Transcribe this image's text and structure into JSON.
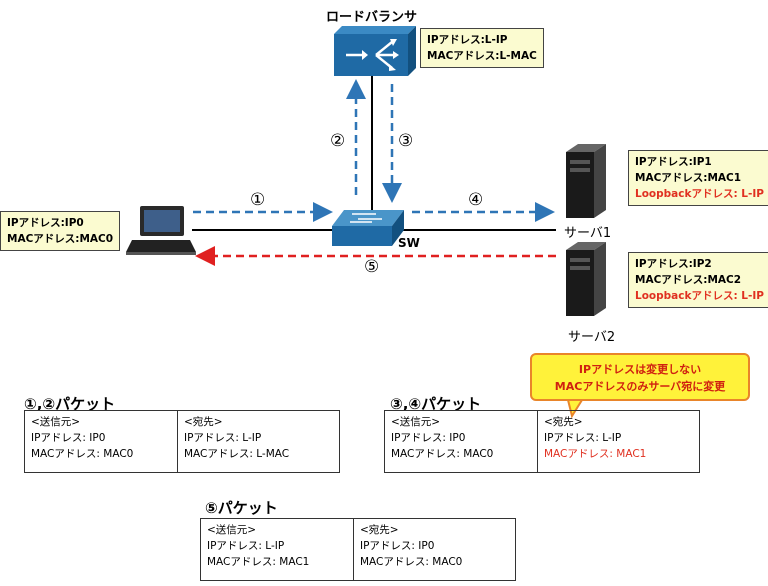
{
  "load_balancer": {
    "title": "ロードバランサ",
    "ip": "IPアドレス:L-IP",
    "mac": "MACアドレス:L-MAC"
  },
  "client": {
    "ip": "IPアドレス:IP0",
    "mac": "MACアドレス:MAC0"
  },
  "switch": {
    "label": "SW"
  },
  "server1": {
    "label": "サーバ1",
    "ip": "IPアドレス:IP1",
    "mac": "MACアドレス:MAC1",
    "loopback": "Loopbackアドレス: L-IP"
  },
  "server2": {
    "label": "サーバ2",
    "ip": "IPアドレス:IP2",
    "mac": "MACアドレス:MAC2",
    "loopback": "Loopbackアドレス: L-IP"
  },
  "steps": {
    "s1": "①",
    "s2": "②",
    "s3": "③",
    "s4": "④",
    "s5": "⑤"
  },
  "callout": {
    "line1": "IPアドレスは変更しない",
    "line2": "MACアドレスのみサーバ宛に変更"
  },
  "packet12": {
    "title": "①,②パケット",
    "src_head": "<送信元>",
    "src_ip": "IPアドレス: IP0",
    "src_mac": "MACアドレス: MAC0",
    "dst_head": "<宛先>",
    "dst_ip": "IPアドレス: L-IP",
    "dst_mac": "MACアドレス: L-MAC"
  },
  "packet34": {
    "title": "③,④パケット",
    "src_head": "<送信元>",
    "src_ip": "IPアドレス: IP0",
    "src_mac": "MACアドレス: MAC0",
    "dst_head": "<宛先>",
    "dst_ip": "IPアドレス: L-IP",
    "dst_mac": "MACアドレス: MAC1"
  },
  "packet5": {
    "title": "⑤パケット",
    "src_head": "<送信元>",
    "src_ip": "IPアドレス: L-IP",
    "src_mac": "MACアドレス: MAC1",
    "dst_head": "<宛先>",
    "dst_ip": "IPアドレス: IP0",
    "dst_mac": "MACアドレス: MAC0"
  },
  "colors": {
    "blue_arrow": "#2e75b6",
    "red_arrow": "#e02020",
    "box_fill": "#fbfbd0",
    "device_blue": "#1f6aa5"
  }
}
